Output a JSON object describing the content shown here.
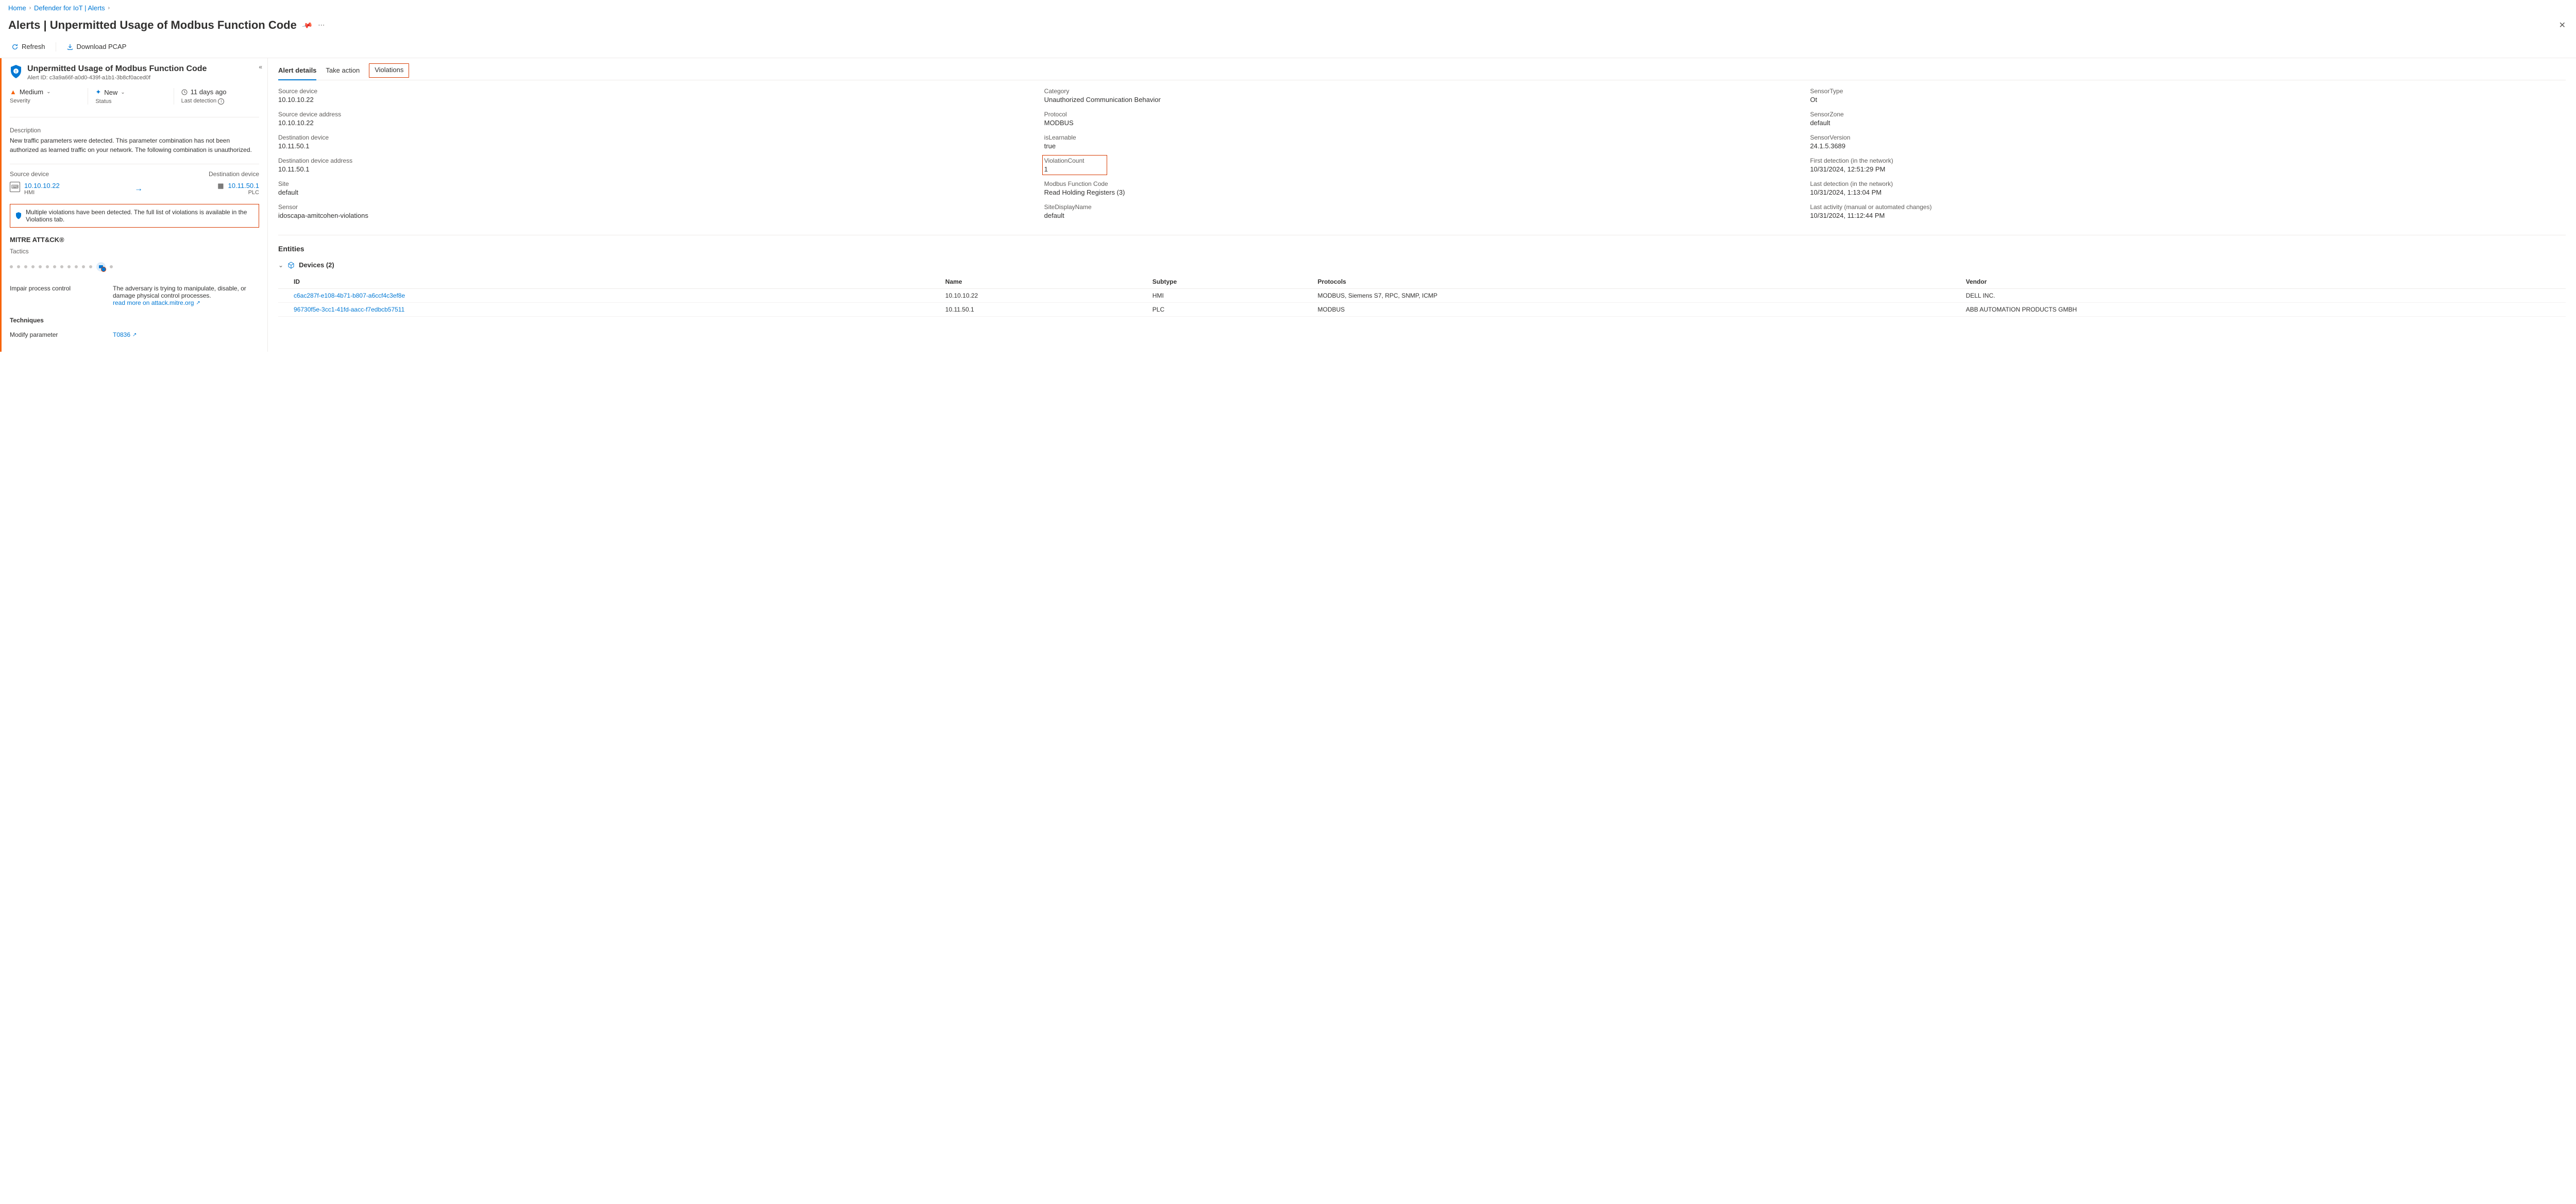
{
  "breadcrumb": {
    "home": "Home",
    "mid": "Defender for IoT | Alerts"
  },
  "page": {
    "title": "Alerts | Unpermitted Usage of Modbus Function Code"
  },
  "toolbar": {
    "refresh": "Refresh",
    "download": "Download PCAP"
  },
  "alert": {
    "title": "Unpermitted Usage of Modbus Function Code",
    "id_label": "Alert ID: c3a9a66f-a0d0-439f-a1b1-3b8cf0aced0f",
    "severity_value": "Medium",
    "severity_label": "Severity",
    "status_value": "New",
    "status_label": "Status",
    "detection_value": "11 days ago",
    "detection_label": "Last detection",
    "description_label": "Description",
    "description_body": "New traffic parameters were detected. This parameter combination has not been authorized as learned traffic on your network. The following combination is unauthorized.",
    "src_label": "Source device",
    "src_ip": "10.10.10.22",
    "src_type": "HMI",
    "dst_label": "Destination device",
    "dst_ip": "10.11.50.1",
    "dst_type": "PLC",
    "violations_note": "Multiple violations have been detected. The full list of violations is available in the Violations tab."
  },
  "mitre": {
    "header": "MITRE ATT&CK®",
    "tactics_label": "Tactics",
    "impair": "Impair process control",
    "impair_desc": "The adversary is trying to manipulate, disable, or damage physical control processes.",
    "read_more": "read more on attack.mitre.org",
    "techniques_label": "Techniques",
    "technique_name": "Modify parameter",
    "technique_id": "T0836"
  },
  "tabs": {
    "details": "Alert details",
    "take_action": "Take action",
    "violations": "Violations"
  },
  "details": {
    "col1": [
      {
        "k": "Source device",
        "v": "10.10.10.22"
      },
      {
        "k": "Source device address",
        "v": "10.10.10.22"
      },
      {
        "k": "Destination device",
        "v": "10.11.50.1"
      },
      {
        "k": "Destination device address",
        "v": "10.11.50.1"
      },
      {
        "k": "Site",
        "v": "default"
      },
      {
        "k": "Sensor",
        "v": "idoscapa-amitcohen-violations"
      }
    ],
    "col2": [
      {
        "k": "Category",
        "v": "Unauthorized Communication Behavior"
      },
      {
        "k": "Protocol",
        "v": "MODBUS"
      },
      {
        "k": "isLearnable",
        "v": "true"
      },
      {
        "k": "ViolationCount",
        "v": "1",
        "boxed": true
      },
      {
        "k": "Modbus Function Code",
        "v": "Read Holding Registers (3)"
      },
      {
        "k": "SiteDisplayName",
        "v": "default"
      }
    ],
    "col3": [
      {
        "k": "SensorType",
        "v": "Ot"
      },
      {
        "k": "SensorZone",
        "v": "default"
      },
      {
        "k": "SensorVersion",
        "v": "24.1.5.3689"
      },
      {
        "k": "First detection (in the network)",
        "v": "10/31/2024, 12:51:29 PM"
      },
      {
        "k": "Last detection (in the network)",
        "v": "10/31/2024, 1:13:04 PM"
      },
      {
        "k": "Last activity (manual or automated changes)",
        "v": "10/31/2024, 11:12:44 PM"
      }
    ]
  },
  "entities": {
    "header": "Entities",
    "group_label": "Devices (2)",
    "columns": {
      "id": "ID",
      "name": "Name",
      "subtype": "Subtype",
      "protocols": "Protocols",
      "vendor": "Vendor"
    },
    "rows": [
      {
        "id": "c6ac287f-e108-4b71-b807-a6ccf4c3ef8e",
        "name": "10.10.10.22",
        "subtype": "HMI",
        "protocols": "MODBUS, Siemens S7, RPC, SNMP, ICMP",
        "vendor": "DELL INC."
      },
      {
        "id": "96730f5e-3cc1-41fd-aacc-f7edbcb57511",
        "name": "10.11.50.1",
        "subtype": "PLC",
        "protocols": "MODBUS",
        "vendor": "ABB AUTOMATION PRODUCTS GMBH"
      }
    ]
  }
}
